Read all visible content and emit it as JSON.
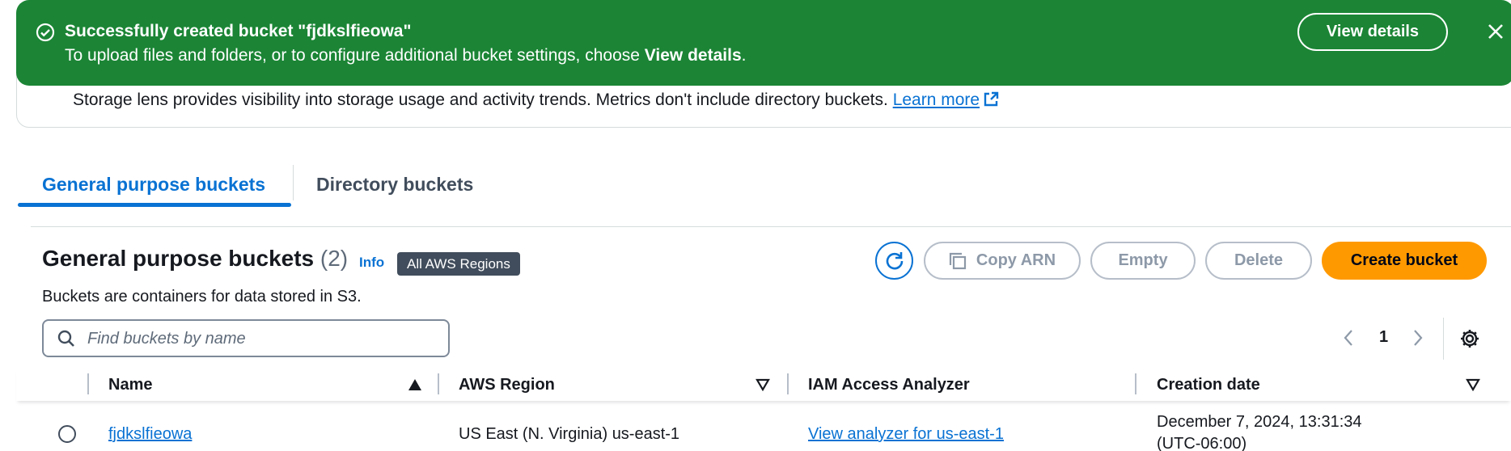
{
  "colors": {
    "success": "#1b8535",
    "link": "#0972d3",
    "primary_button": "#ff9900",
    "badge": "#414d5c"
  },
  "flash": {
    "icon": "check-circle-icon",
    "title": "Successfully created bucket \"fjdkslfieowa\"",
    "message_prefix": "To upload files and folders, or to configure additional bucket settings, choose ",
    "message_bold": "View details",
    "message_suffix": ".",
    "view_details_label": "View details",
    "close_icon": "close-icon"
  },
  "storage_lens": {
    "text": "Storage lens provides visibility into storage usage and activity trends. Metrics don't include directory buckets.",
    "learn_more": "Learn more",
    "external_icon": "external-link-icon"
  },
  "tabs": [
    {
      "label": "General purpose buckets",
      "selected": true
    },
    {
      "label": "Directory buckets",
      "selected": false
    }
  ],
  "panel": {
    "title": "General purpose buckets",
    "count": "(2)",
    "info": "Info",
    "region_badge": "All AWS Regions",
    "description": "Buckets are containers for data stored in S3.",
    "buttons": {
      "refresh_icon": "refresh-icon",
      "copy_arn": "Copy ARN",
      "empty": "Empty",
      "delete": "Delete",
      "create": "Create bucket"
    },
    "search": {
      "placeholder": "Find buckets by name",
      "value": ""
    },
    "pagination": {
      "current_page": "1"
    }
  },
  "table": {
    "columns": [
      "Name",
      "AWS Region",
      "IAM Access Analyzer",
      "Creation date"
    ],
    "rows": [
      {
        "name": "fjdkslfieowa",
        "region": "US East (N. Virginia) us-east-1",
        "analyzer": "View analyzer for us-east-1",
        "created_line1": "December 7, 2024, 13:31:34",
        "created_line2": "(UTC-06:00)"
      }
    ]
  }
}
